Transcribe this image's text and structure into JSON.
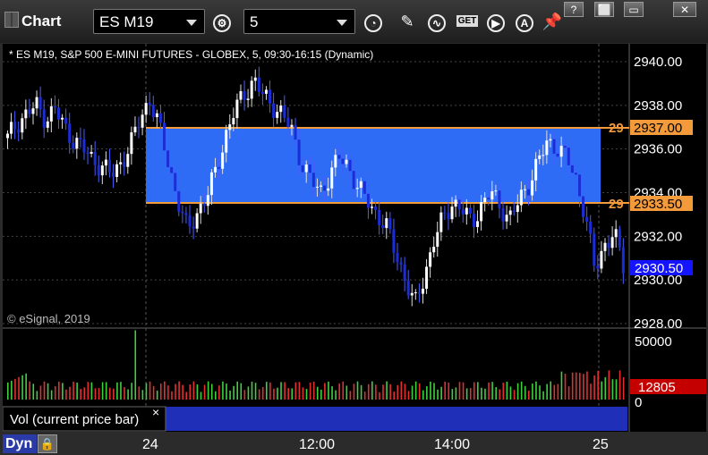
{
  "window": {
    "title": "Chart",
    "symbol": "ES M19",
    "interval": "5",
    "controls": [
      "?",
      "⬜",
      "▭",
      "✕"
    ]
  },
  "toolbar_icons": [
    "settings-gear-icon",
    "clock-icon",
    "pencil-draw-icon",
    "indicator-chart-icon",
    "get-data-icon",
    "play-icon",
    "a-alert-icon",
    "pin-icon"
  ],
  "toolbar_labels": {
    "get": "GET",
    "alert": "A"
  },
  "chart": {
    "header": "* ES M19, S&P 500 E-MINI FUTURES - GLOBEX, 5, 09:30-16:15 (Dynamic)",
    "watermark": "© eSignal, 2019",
    "price_ticks": [
      "2940.00",
      "2938.00",
      "2936.00",
      "2934.00",
      "2932.00",
      "2930.00",
      "2928.00"
    ],
    "upper_line_label": "2937.00",
    "lower_line_label": "2933.50",
    "line_prefix": "29",
    "last_price_label": "2930.50",
    "volume_ticks": [
      "50000",
      "0"
    ],
    "volume_last": "12805",
    "volume_study_label": "Vol (current price bar)",
    "close_study": "×",
    "time_labels": [
      "24",
      "12:00",
      "14:00",
      "25"
    ],
    "colors": {
      "zone": "#2e6cf6",
      "level_line": "#f39a3b",
      "last_price_bg": "#1414ff",
      "volume_last_bg": "#c40000",
      "bull_candle": "#ffffff",
      "bear_candle": "#1b2dd6"
    }
  },
  "status": {
    "mode": "Dyn"
  },
  "chart_data": {
    "type": "candlestick",
    "price_range": [
      2928,
      2940
    ],
    "zone": {
      "upper": 2937.0,
      "lower": 2933.5
    },
    "last_price": 2930.5,
    "volume_range": [
      0,
      50000
    ],
    "last_volume": 12805
  }
}
